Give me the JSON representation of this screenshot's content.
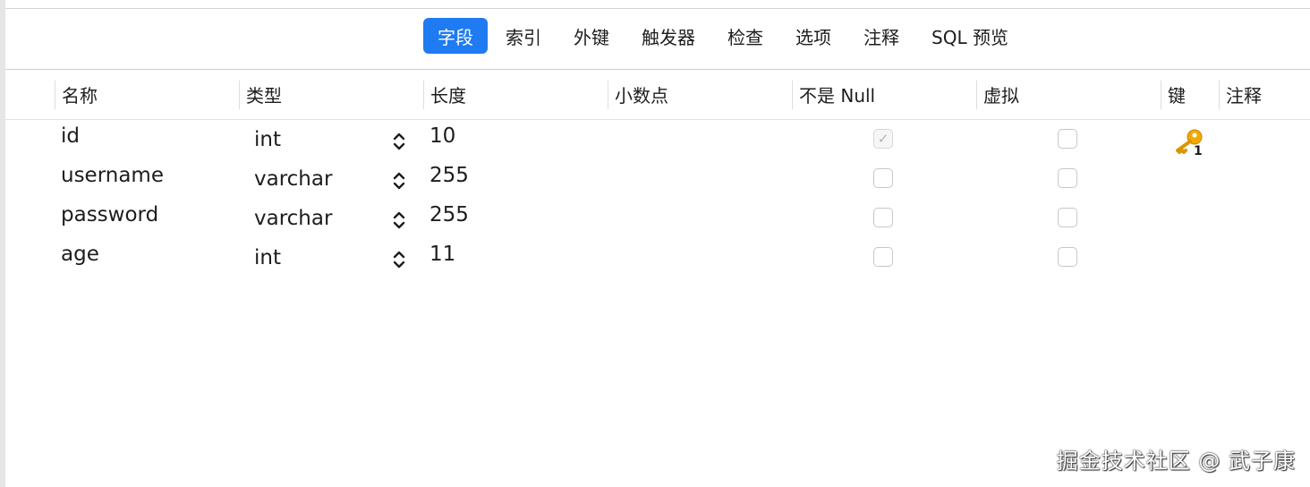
{
  "tabs": [
    {
      "label": "字段",
      "active": true
    },
    {
      "label": "索引",
      "active": false
    },
    {
      "label": "外键",
      "active": false
    },
    {
      "label": "触发器",
      "active": false
    },
    {
      "label": "检查",
      "active": false
    },
    {
      "label": "选项",
      "active": false
    },
    {
      "label": "注释",
      "active": false
    },
    {
      "label": "SQL 预览",
      "active": false
    }
  ],
  "columns": {
    "name": "名称",
    "type": "类型",
    "length": "长度",
    "decimals": "小数点",
    "not_null": "不是 Null",
    "virtual": "虚拟",
    "key": "键",
    "comment": "注释"
  },
  "fields": [
    {
      "name": "id",
      "type": "int",
      "length": "10",
      "not_null": true,
      "virtual": false,
      "key": "1"
    },
    {
      "name": "username",
      "type": "varchar",
      "length": "255",
      "not_null": false,
      "virtual": false,
      "key": ""
    },
    {
      "name": "password",
      "type": "varchar",
      "length": "255",
      "not_null": false,
      "virtual": false,
      "key": ""
    },
    {
      "name": "age",
      "type": "int",
      "length": "11",
      "not_null": false,
      "virtual": false,
      "key": ""
    }
  ],
  "icons": {
    "key": "key-icon",
    "stepper": "up-down-stepper-icon",
    "check": "checkmark-icon"
  },
  "colors": {
    "accent": "#1f7bf2",
    "key_gold": "#f2a900"
  },
  "watermark": "掘金技术社区 @ 武子康"
}
